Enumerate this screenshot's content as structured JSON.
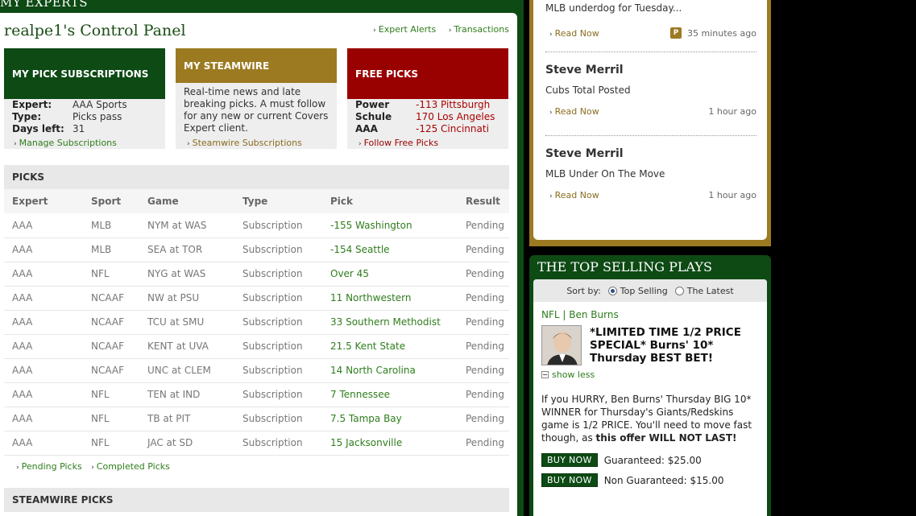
{
  "left": {
    "section_title": "MY EXPERTS",
    "control_panel_title": "realpe1's Control Panel",
    "top_links": [
      "Expert Alerts",
      "Transactions"
    ]
  },
  "subscriptions": {
    "title": "MY PICK SUBSCRIPTIONS",
    "expert_label": "Expert:",
    "expert_value": "AAA Sports",
    "type_label": "Type:",
    "type_value": "Picks pass",
    "days_label": "Days left:",
    "days_value": "31",
    "link": "Manage Subscriptions"
  },
  "steamwire": {
    "title": "MY STEAMWIRE",
    "description": "Real-time news and late breaking picks. A must follow for any new or current Covers Expert client.",
    "link": "Steamwire Subscriptions"
  },
  "free_picks": {
    "title": "FREE PICKS",
    "rows": [
      {
        "name": "Power",
        "pick": "-113 Pittsburgh"
      },
      {
        "name": "Schule",
        "pick": "170 Los Angeles"
      },
      {
        "name": "AAA",
        "pick": "-125 Cincinnati"
      }
    ],
    "link": "Follow Free Picks"
  },
  "picks": {
    "title": "PICKS",
    "columns": [
      "Expert",
      "Sport",
      "Game",
      "Type",
      "Pick",
      "Result"
    ],
    "rows": [
      [
        "AAA",
        "MLB",
        "NYM at WAS",
        "Subscription",
        "-155 Washington",
        "Pending"
      ],
      [
        "AAA",
        "MLB",
        "SEA at TOR",
        "Subscription",
        "-154 Seattle",
        "Pending"
      ],
      [
        "AAA",
        "NFL",
        "NYG at WAS",
        "Subscription",
        "Over 45",
        "Pending"
      ],
      [
        "AAA",
        "NCAAF",
        "NW at PSU",
        "Subscription",
        "11 Northwestern",
        "Pending"
      ],
      [
        "AAA",
        "NCAAF",
        "TCU at SMU",
        "Subscription",
        "33 Southern Methodist",
        "Pending"
      ],
      [
        "AAA",
        "NCAAF",
        "KENT at UVA",
        "Subscription",
        "21.5 Kent State",
        "Pending"
      ],
      [
        "AAA",
        "NCAAF",
        "UNC at CLEM",
        "Subscription",
        "14 North Carolina",
        "Pending"
      ],
      [
        "AAA",
        "NFL",
        "TEN at IND",
        "Subscription",
        "7 Tennessee",
        "Pending"
      ],
      [
        "AAA",
        "NFL",
        "TB at PIT",
        "Subscription",
        "7.5 Tampa Bay",
        "Pending"
      ],
      [
        "AAA",
        "NFL",
        "JAC at SD",
        "Subscription",
        "15 Jacksonville",
        "Pending"
      ]
    ],
    "links": [
      "Pending Picks",
      "Completed Picks"
    ]
  },
  "steamwire_picks": {
    "title": "STEAMWIRE PICKS"
  },
  "feed": {
    "items": [
      {
        "author": "",
        "text": "MLB underdog for Tuesday...",
        "read_more": "Read Now",
        "badge": "P",
        "ago": "35 minutes ago"
      },
      {
        "author": "Steve Merril",
        "text": "Cubs Total Posted",
        "read_more": "Read Now",
        "ago": "1 hour ago"
      },
      {
        "author": "Steve Merril",
        "text": "MLB Under On The Move",
        "read_more": "Read Now",
        "ago": "1 hour ago"
      }
    ]
  },
  "top_selling": {
    "title": "THE TOP SELLING PLAYS",
    "sort_label": "Sort by:",
    "sort_options": [
      "Top Selling",
      "The Latest"
    ],
    "category": "NFL",
    "expert": "Ben Burns",
    "headline": "*LIMITED TIME 1/2 PRICE SPECIAL* Burns' 10* Thursday BEST BET!",
    "show_less": "show less",
    "body": "If you HURRY, Ben Burns' Thursday BIG 10* WINNER for Thursday's Giants/Redskins game is 1/2 PRICE. You'll need to move fast though, as",
    "body_bold": "this offer WILL NOT LAST!",
    "buy_label": "BUY NOW",
    "guaranteed": "Guaranteed: $25.00",
    "non_guaranteed": "Non Guaranteed: $15.00"
  },
  "colors": {
    "green": "#0d4a14",
    "gold": "#9c7a21",
    "red": "#990000",
    "link_green": "#2e7d1c"
  }
}
